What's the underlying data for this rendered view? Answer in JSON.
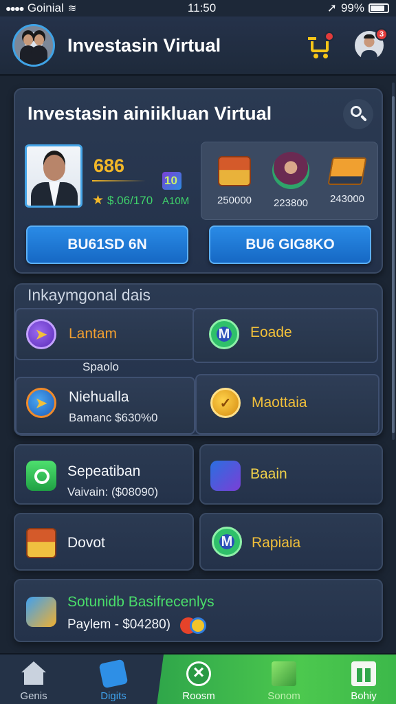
{
  "status_bar": {
    "carrier": "Goinial",
    "time": "11:50",
    "battery": "99%"
  },
  "header": {
    "title": "Investasin Virtual"
  },
  "main_card": {
    "title": "Investasin ainiikluan Virtual",
    "stat_value": "686",
    "stat_amount": "$.06/170",
    "cube_value": "10",
    "stat_aux": "A10M",
    "coins": [
      {
        "value": "250000"
      },
      {
        "value": "223800"
      },
      {
        "value": "243000"
      }
    ],
    "button_left": "BU61SD 6N",
    "button_right": "BU6 GIG8KO"
  },
  "section": {
    "title": "Inkaymgonal dais",
    "items": [
      {
        "label": "Lantam"
      },
      {
        "label": "Eoade"
      },
      {
        "label": "Spaolo"
      },
      {
        "label": "Niehualla",
        "sub": "Bamanc $630%0"
      },
      {
        "label": "Maottaia"
      }
    ]
  },
  "cards": {
    "spec": {
      "label": "Sepeatiban",
      "sub": "Vaivain: ($08090)"
    },
    "baain": {
      "label": "Baain"
    },
    "dovot": {
      "label": "Dovot"
    },
    "rapiaia": {
      "label": "Rapiaia"
    },
    "summary": {
      "label": "Sotunidb Basifrecenlys",
      "sub": "Paylem - $04280)"
    }
  },
  "bottom_nav": [
    {
      "label": "Genis"
    },
    {
      "label": "Digits"
    },
    {
      "label": "Roosm"
    },
    {
      "label": "Sonom"
    },
    {
      "label": "Bohiy"
    }
  ],
  "colors": {
    "accent_blue": "#2a8be6",
    "gold": "#f2b728",
    "green": "#3fd26b",
    "nav_green": "#3cb84a"
  }
}
